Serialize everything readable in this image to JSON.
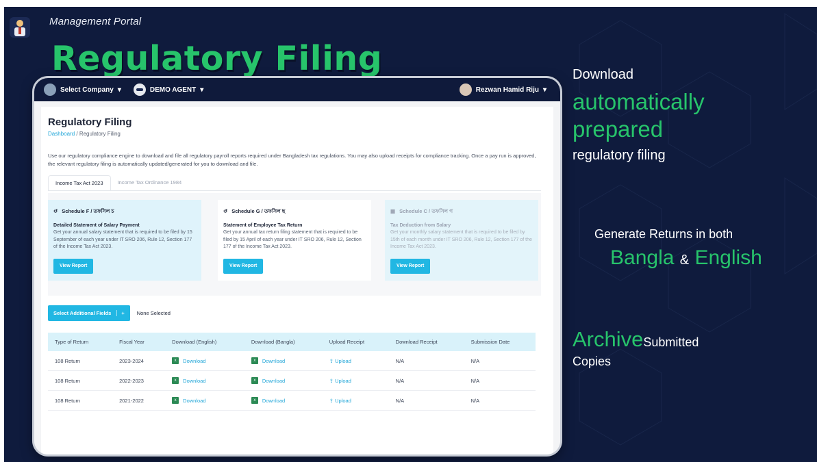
{
  "slide": {
    "portal_label": "Management Portal",
    "title": "Regulatory Filing",
    "colors": {
      "background": "#0f1b3d",
      "accent_green": "#27c46b",
      "accent_blue": "#21b7e3"
    }
  },
  "right_panel": {
    "line1": "Download",
    "line2": "automatically",
    "line3": "prepared",
    "line4": "regulatory filing",
    "line5": "Generate Returns in both",
    "bangla": "Bangla",
    "amp": "&",
    "english": "English",
    "archive": "Archive",
    "submitted": "Submitted",
    "copies": "Copies"
  },
  "app": {
    "topbar": {
      "company_select": "Select Company",
      "agent": "DEMO AGENT",
      "user": "Rezwan Hamid Riju"
    },
    "page_title": "Regulatory Filing",
    "breadcrumb_link": "Dashboard",
    "breadcrumb_current": "/ Regulatory Filing",
    "description": "Use our regulatory compliance engine to download and file all regulatory payroll reports required under Bangladesh tax regulations. You may also upload receipts for compliance tracking. Once a pay run is approved, the relevant regulatory filing is automatically updated/generated for you to download and file.",
    "tabs": [
      "Income Tax Act 2023",
      "Income Tax Ordinance 1984"
    ],
    "cards": [
      {
        "heading": "Schedule F / তফসিল চ",
        "subheading": "Detailed Statement of Salary Payment",
        "body": "Get your annual salary statement that is required to be filed by 15 September of each year under IT SRO 206, Rule 12, Section 177 of the Income Tax Act 2023.",
        "button": "View Report"
      },
      {
        "heading": "Schedule G / তফসিল ছ",
        "subheading": "Statement of Employee Tax Return",
        "body": "Get your annual tax return filing statement that is required to be filed by 15 April of each year under IT SRO 206, Rule 12, Section 177 of the Income Tax Act 2023.",
        "button": "View Report"
      },
      {
        "heading": "Schedule C / তফসিল গ",
        "subheading": "Tax Deduction from Salary",
        "body": "Get your monthly salary statement that is required to be filed by 15th of each month under IT SRO 206, Rule 12, Section 177 of the Income Tax Act 2023.",
        "button": "View Report"
      }
    ],
    "extra_fields_button": "Select Additional Fields",
    "extra_fields_plus": "+",
    "none_selected": "None Selected",
    "table": {
      "headers": [
        "Type of Return",
        "Fiscal Year",
        "Download (English)",
        "Download (Bangla)",
        "Upload Receipt",
        "Download Receipt",
        "Submission Date"
      ],
      "rows": [
        {
          "type": "108 Return",
          "year": "2023-2024",
          "dl_en": "Download",
          "dl_bn": "Download",
          "upload": "Upload",
          "receipt": "N/A",
          "date": "N/A"
        },
        {
          "type": "108 Return",
          "year": "2022-2023",
          "dl_en": "Download",
          "dl_bn": "Download",
          "upload": "Upload",
          "receipt": "N/A",
          "date": "N/A"
        },
        {
          "type": "108 Return",
          "year": "2021-2022",
          "dl_en": "Download",
          "dl_bn": "Download",
          "upload": "Upload",
          "receipt": "N/A",
          "date": "N/A"
        }
      ]
    }
  }
}
